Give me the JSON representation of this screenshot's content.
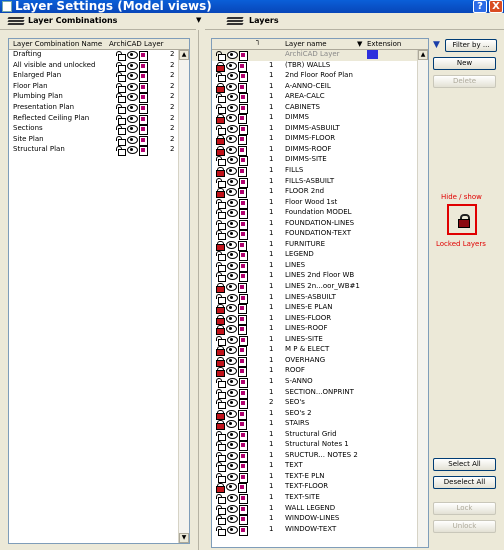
{
  "window": {
    "title": "Layer Settings (Model views)",
    "help_label": "?",
    "close_label": "X"
  },
  "combinations_panel": {
    "title": "Layer Combinations",
    "col_name": "Layer Combination Name",
    "col_layer": "ArchiCAD Layer",
    "rows": [
      {
        "name": "Drafting",
        "value": "2"
      },
      {
        "name": "All visible and unlocked",
        "value": "2"
      },
      {
        "name": "Enlarged Plan",
        "value": "2"
      },
      {
        "name": "Floor Plan",
        "value": "2"
      },
      {
        "name": "Plumbing Plan",
        "value": "2"
      },
      {
        "name": "Presentation Plan",
        "value": "2"
      },
      {
        "name": "Reflected Ceiling Plan",
        "value": "2"
      },
      {
        "name": "Sections",
        "value": "2"
      },
      {
        "name": "Site Plan",
        "value": "2"
      },
      {
        "name": "Structural Plan",
        "value": "2"
      }
    ]
  },
  "layers_panel": {
    "title": "Layers",
    "col_name": "Layer name",
    "col_ext": "Extension",
    "rows": [
      {
        "lock": "unlocked",
        "num": "",
        "name": "ArchiCAD Layer",
        "selected": true
      },
      {
        "lock": "locked",
        "num": "1",
        "name": "(TBR) WALLS"
      },
      {
        "lock": "unlocked",
        "num": "1",
        "name": "2nd Floor Roof Plan"
      },
      {
        "lock": "locked",
        "num": "1",
        "name": "A-ANNO-CEIL"
      },
      {
        "lock": "unlocked",
        "num": "1",
        "name": "AREA-CALC"
      },
      {
        "lock": "unlocked",
        "num": "1",
        "name": "CABINETS"
      },
      {
        "lock": "locked",
        "num": "1",
        "name": "DIMMS"
      },
      {
        "lock": "unlocked",
        "num": "1",
        "name": "DIMMS-ASBUILT"
      },
      {
        "lock": "locked",
        "num": "1",
        "name": "DIMMS-FLOOR"
      },
      {
        "lock": "locked",
        "num": "1",
        "name": "DIMMS-ROOF"
      },
      {
        "lock": "unlocked",
        "num": "1",
        "name": "DIMMS-SITE"
      },
      {
        "lock": "locked",
        "num": "1",
        "name": "FILLS"
      },
      {
        "lock": "unlocked",
        "num": "1",
        "name": "FILLS-ASBUILT"
      },
      {
        "lock": "locked",
        "num": "1",
        "name": "FLOOR 2nd"
      },
      {
        "lock": "unlocked",
        "num": "1",
        "name": "Floor Wood 1st"
      },
      {
        "lock": "unlocked",
        "num": "1",
        "name": "Foundation MODEL"
      },
      {
        "lock": "unlocked",
        "num": "1",
        "name": "FOUNDATION-LINES"
      },
      {
        "lock": "unlocked",
        "num": "1",
        "name": "FOUNDATION-TEXT"
      },
      {
        "lock": "locked",
        "num": "1",
        "name": "FURNITURE"
      },
      {
        "lock": "unlocked",
        "num": "1",
        "name": "LEGEND"
      },
      {
        "lock": "unlocked",
        "num": "1",
        "name": "LINES"
      },
      {
        "lock": "unlocked",
        "num": "1",
        "name": "LINES 2nd Floor WB"
      },
      {
        "lock": "locked",
        "num": "1",
        "name": "LINES 2n...oor_WB#1"
      },
      {
        "lock": "unlocked",
        "num": "1",
        "name": "LINES-ASBUILT"
      },
      {
        "lock": "locked",
        "num": "1",
        "name": "LINES-E PLAN"
      },
      {
        "lock": "locked",
        "num": "1",
        "name": "LINES-FLOOR"
      },
      {
        "lock": "locked",
        "num": "1",
        "name": "LINES-ROOF"
      },
      {
        "lock": "unlocked",
        "num": "1",
        "name": "LINES-SITE"
      },
      {
        "lock": "locked",
        "num": "1",
        "name": "M P & ELECT"
      },
      {
        "lock": "locked",
        "num": "1",
        "name": "OVERHANG"
      },
      {
        "lock": "locked",
        "num": "1",
        "name": "ROOF"
      },
      {
        "lock": "unlocked",
        "num": "1",
        "name": "S-ANNO"
      },
      {
        "lock": "unlocked",
        "num": "1",
        "name": "SECTION...ONPRINT"
      },
      {
        "lock": "unlocked",
        "num": "2",
        "name": "SEO's"
      },
      {
        "lock": "locked",
        "num": "1",
        "name": "SEO's 2"
      },
      {
        "lock": "locked",
        "num": "1",
        "name": "STAIRS"
      },
      {
        "lock": "unlocked",
        "num": "1",
        "name": "Structural Grid"
      },
      {
        "lock": "unlocked",
        "num": "1",
        "name": "Structural Notes 1"
      },
      {
        "lock": "unlocked",
        "num": "1",
        "name": "SRUCTUR... NOTES 2"
      },
      {
        "lock": "unlocked",
        "num": "1",
        "name": "TEXT"
      },
      {
        "lock": "unlocked",
        "num": "1",
        "name": "TEXT-E PLN"
      },
      {
        "lock": "locked",
        "num": "1",
        "name": "TEXT-FLOOR"
      },
      {
        "lock": "unlocked",
        "num": "1",
        "name": "TEXT-SITE"
      },
      {
        "lock": "unlocked",
        "num": "1",
        "name": "WALL LEGEND"
      },
      {
        "lock": "unlocked",
        "num": "1",
        "name": "WINDOW-LINES"
      },
      {
        "lock": "unlocked",
        "num": "1",
        "name": "WINDOW-TEXT"
      }
    ]
  },
  "buttons": {
    "filter": "Filter by ...",
    "new": "New",
    "delete": "Delete",
    "select_all": "Select All",
    "deselect_all": "Deselect All",
    "lock": "Lock",
    "unlock": "Unlock"
  },
  "annotation": {
    "top": "Hide / show",
    "bottom": "Locked Layers",
    "color": "#e00000"
  },
  "icons": {
    "lock": "padlock-icon",
    "eye": "eye-icon",
    "layer": "layer-doc-icon",
    "filter": "funnel-icon"
  }
}
